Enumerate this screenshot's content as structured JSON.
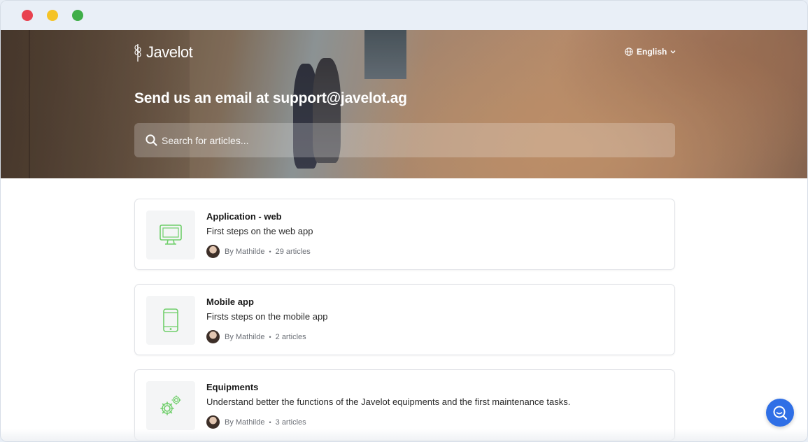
{
  "window": {
    "controls": [
      "close",
      "minimize",
      "maximize"
    ]
  },
  "header": {
    "logo_text": "Javelot",
    "language": "English",
    "title": "Send us an email at support@javelot.ag",
    "search": {
      "placeholder": "Search for articles...",
      "value": ""
    }
  },
  "collections": [
    {
      "title": "Application - web",
      "description": "First steps on the web app",
      "author": "By Mathilde",
      "count": "29 articles",
      "icon": "desktop-monitor-icon"
    },
    {
      "title": "Mobile app",
      "description": "Firsts steps on the mobile app",
      "author": "By Mathilde",
      "count": "2 articles",
      "icon": "mobile-phone-icon"
    },
    {
      "title": "Equipments",
      "description": "Understand better the functions of the Javelot equipments and the first maintenance tasks.",
      "author": "By Mathilde",
      "count": "3 articles",
      "icon": "gears-icon"
    }
  ],
  "colors": {
    "accent": "#2f6fe6",
    "icon_green": "#6fcf6a",
    "close": "#e8414f",
    "minimize": "#f5c327",
    "maximize": "#3fae48"
  },
  "help_button": {
    "icon": "search-help-icon"
  }
}
